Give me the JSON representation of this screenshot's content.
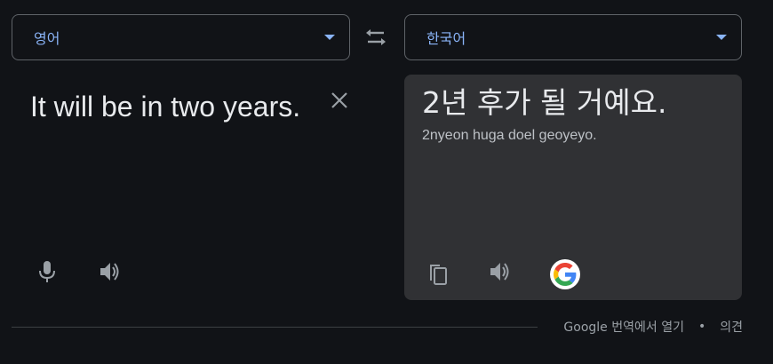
{
  "source": {
    "language": "영어",
    "text": "It will be in two years."
  },
  "target": {
    "language": "한국어",
    "text": "2년 후가 될 거예요.",
    "romanization": "2nyeon huga doel geoyeyo."
  },
  "icons": {
    "swap": "swap-icon",
    "clear": "close-icon",
    "mic": "microphone-icon",
    "speaker": "speaker-icon",
    "copy": "copy-icon",
    "google": "google-logo-icon"
  },
  "footer": {
    "open_in_translate": "Google 번역에서 열기",
    "separator": "•",
    "feedback": "의견"
  },
  "colors": {
    "background": "#111317",
    "panel": "#303134",
    "accent": "#8ab4f8",
    "text": "#e8eaed",
    "muted": "#9aa0a6"
  }
}
